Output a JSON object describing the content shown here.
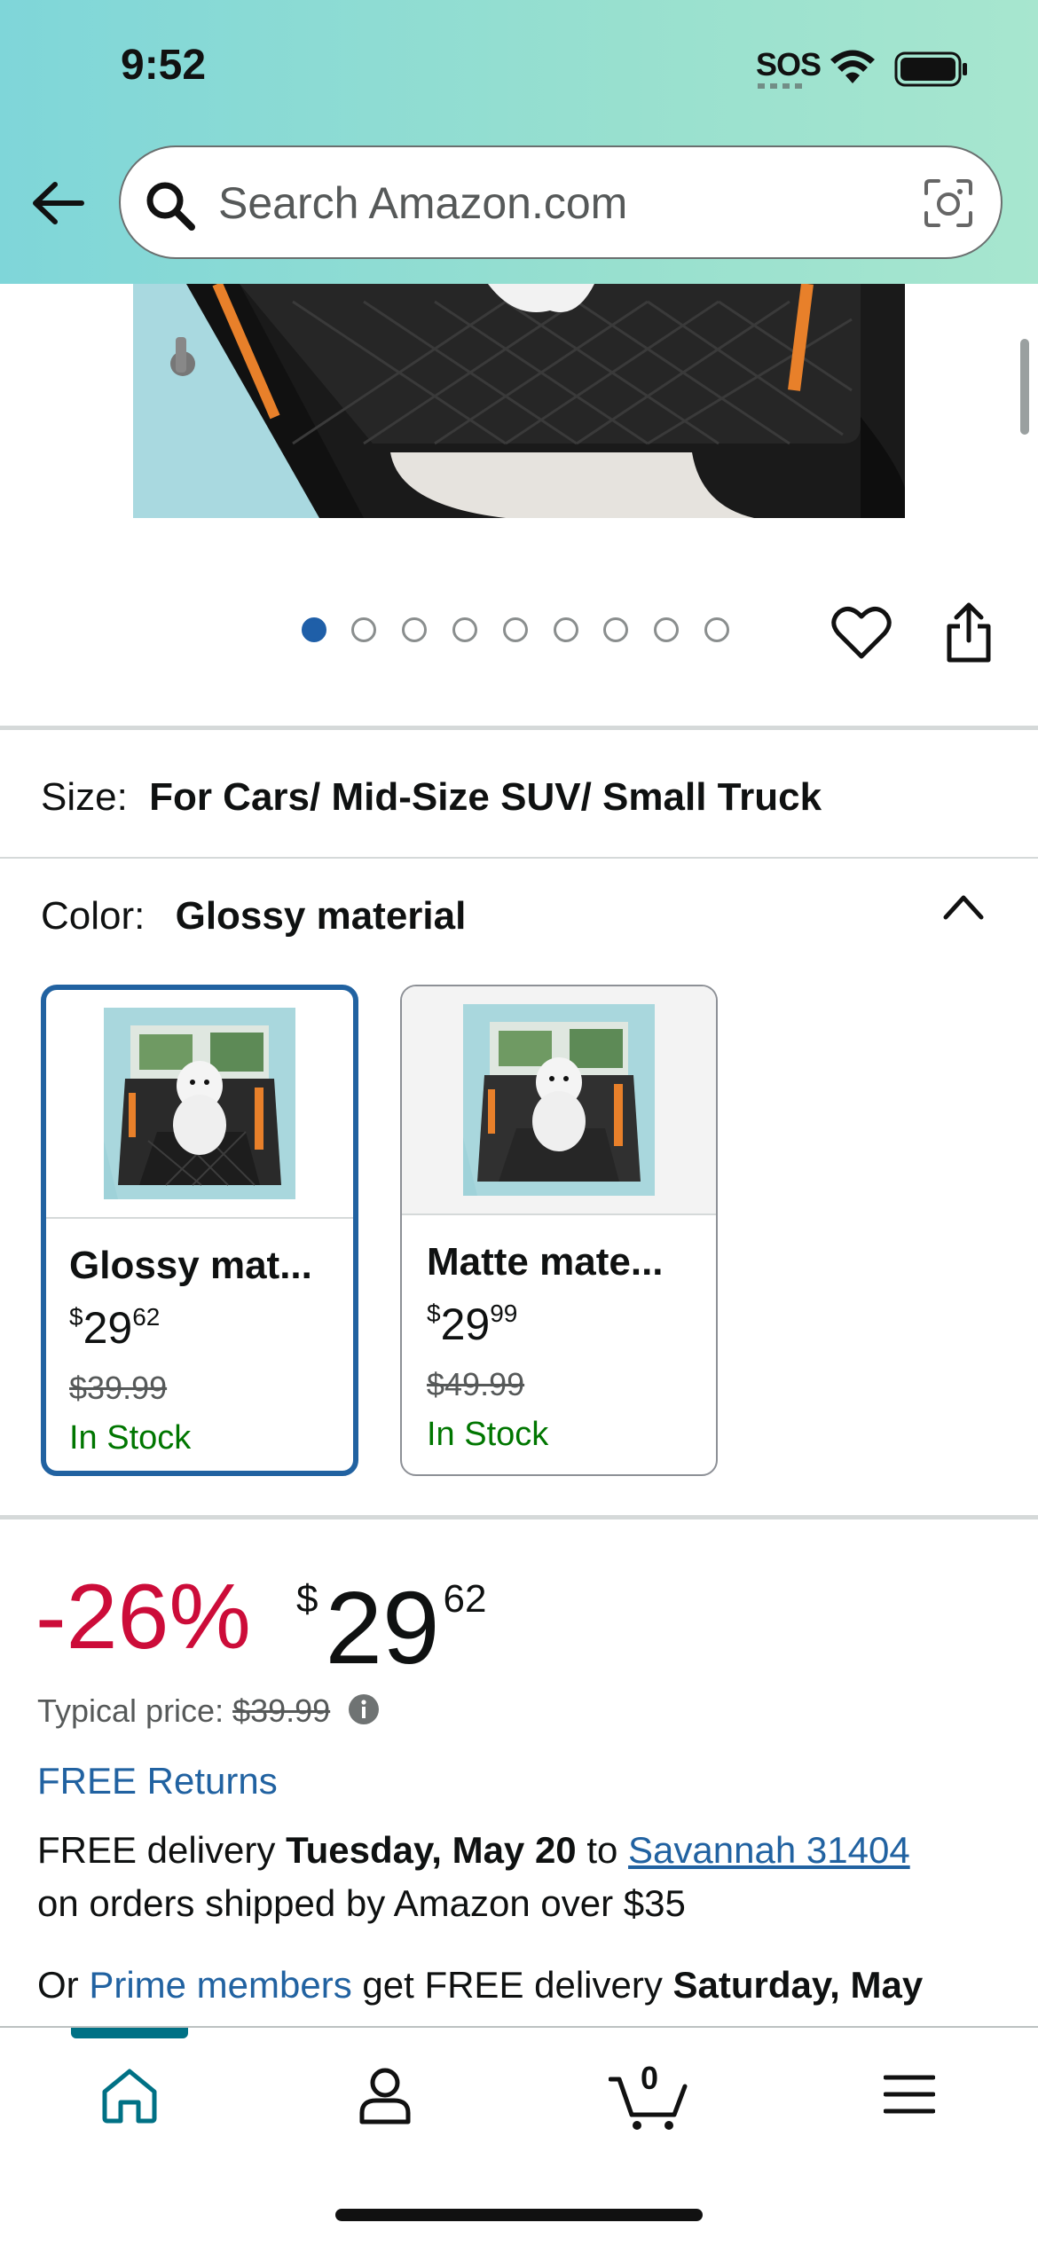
{
  "status_bar": {
    "time": "9:52",
    "sos": "SOS"
  },
  "search": {
    "placeholder": "Search Amazon.com"
  },
  "gallery": {
    "image_count": 9,
    "active_index": 0
  },
  "size": {
    "label": "Size:",
    "value": "For Cars/ Mid-Size SUV/ Small Truck"
  },
  "color": {
    "label": "Color:",
    "value": "Glossy material",
    "options": [
      {
        "name": "Glossy mat...",
        "price_symbol": "$",
        "price_whole": "29",
        "price_cents": "62",
        "list_price": "$39.99",
        "stock": "In Stock",
        "selected": true
      },
      {
        "name": "Matte mate...",
        "price_symbol": "$",
        "price_whole": "29",
        "price_cents": "99",
        "list_price": "$49.99",
        "stock": "In Stock",
        "selected": false
      }
    ]
  },
  "price": {
    "discount": "-26%",
    "symbol": "$",
    "whole": "29",
    "cents": "62",
    "typical_label": "Typical price:",
    "typical_value": "$39.99"
  },
  "returns": "FREE Returns",
  "delivery": {
    "prefix": "FREE delivery",
    "date": "Tuesday, May 20",
    "to": "to",
    "location": "Savannah 31404",
    "suffix": "on orders shipped by Amazon over $35"
  },
  "prime": {
    "prefix": "Or",
    "link": "Prime members",
    "middle": "get FREE delivery",
    "date": "Saturday, May"
  },
  "cart": {
    "count": "0"
  },
  "colors": {
    "accent_blue": "#2162a1",
    "deal_red": "#cc0c39",
    "stock_green": "#007600",
    "nav_teal": "#007185"
  }
}
